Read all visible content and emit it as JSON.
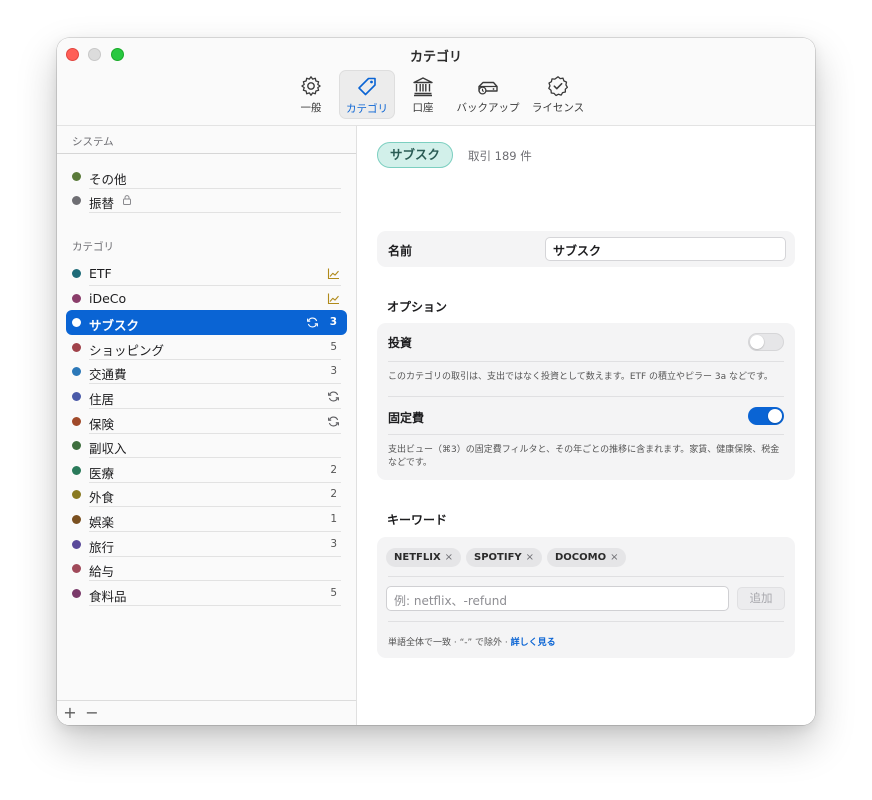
{
  "window": {
    "title": "カテゴリ"
  },
  "toolbar": {
    "tabs": [
      {
        "label": "一般",
        "icon": "gear-icon"
      },
      {
        "label": "カテゴリ",
        "icon": "tag-icon",
        "active": true
      },
      {
        "label": "口座",
        "icon": "bank-icon"
      },
      {
        "label": "バックアップ",
        "icon": "backup-drive-icon"
      },
      {
        "label": "ライセンス",
        "icon": "checkmark-seal-icon"
      }
    ]
  },
  "sidebar": {
    "system_title": "システム",
    "system_items": [
      {
        "name": "その他",
        "color": "#5a7a3a"
      },
      {
        "name": "振替",
        "color": "#6e6e73",
        "icon": "lock-icon"
      }
    ],
    "category_title": "カテゴリ",
    "categories": [
      {
        "name": "ETF",
        "color": "#1e6b78",
        "icon": "chart-icon"
      },
      {
        "name": "iDeCo",
        "color": "#8a3d6a",
        "icon": "chart-icon"
      },
      {
        "name": "サブスク",
        "color": "#ffffff",
        "icon": "recurring-icon",
        "count": "3",
        "selected": true
      },
      {
        "name": "ショッピング",
        "color": "#a0424a",
        "count": "5"
      },
      {
        "name": "交通費",
        "color": "#2c78b8",
        "count": "3"
      },
      {
        "name": "住居",
        "color": "#4a5aa8",
        "icon": "recurring-icon"
      },
      {
        "name": "保険",
        "color": "#a04a2a",
        "icon": "recurring-icon"
      },
      {
        "name": "副収入",
        "color": "#3e6e3e"
      },
      {
        "name": "医療",
        "color": "#2a7a5a",
        "count": "2"
      },
      {
        "name": "外食",
        "color": "#8a7a22",
        "count": "2"
      },
      {
        "name": "娯楽",
        "color": "#7a5020",
        "count": "1"
      },
      {
        "name": "旅行",
        "color": "#5a4a9a",
        "count": "3"
      },
      {
        "name": "給与",
        "color": "#a04a5a"
      },
      {
        "name": "食料品",
        "color": "#7a3a6a",
        "count": "5"
      }
    ],
    "footer": {
      "add": "+",
      "remove": "−"
    }
  },
  "detail": {
    "pill": "サブスク",
    "transactions": "取引 189 件",
    "name_label": "名前",
    "name_value": "サブスク",
    "options_heading": "オプション",
    "investment": {
      "label": "投資",
      "on": false,
      "description": "このカテゴリの取引は、支出ではなく投資として数えます。ETF の積立やピラー 3a などです。"
    },
    "fixed_cost": {
      "label": "固定費",
      "on": true,
      "description": "支出ビュー（⌘3）の固定費フィルタと、その年ごとの推移に含まれます。家賃、健康保険、税金などです。"
    },
    "keywords_heading": "キーワード",
    "keywords": [
      "NETFLIX",
      "SPOTIFY",
      "DOCOMO"
    ],
    "chip_remove": "×",
    "keyword_placeholder": "例: netflix、-refund",
    "add_label": "追加",
    "hint_text": "単語全体で一致 · “-” で除外 · ",
    "hint_link": "詳しく見る"
  },
  "colors": {
    "accent": "#0a64d4",
    "pill_bg": "#d2f0ea"
  }
}
